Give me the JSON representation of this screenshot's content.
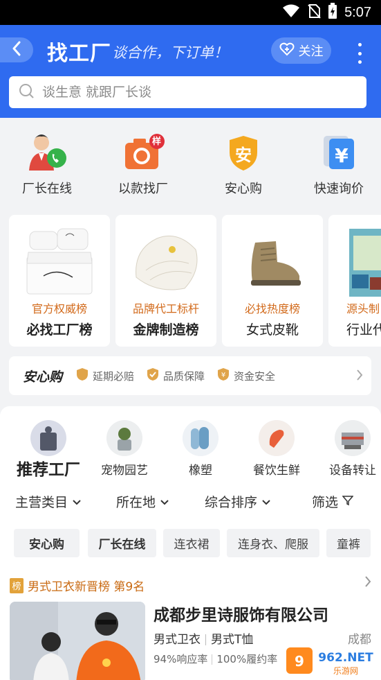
{
  "status_bar": {
    "time": "5:07"
  },
  "header": {
    "brand": "找工厂",
    "slogan": "谈合作，下订单！",
    "follow_label": "关注",
    "search_placeholder": "谈生意 就跟厂长谈"
  },
  "quick_entries": [
    {
      "label": "厂长在线",
      "icon": "factory-manager-phone-icon"
    },
    {
      "label": "以款找厂",
      "icon": "camera-sample-icon",
      "badge": "样"
    },
    {
      "label": "安心购",
      "icon": "shield-icon",
      "glyph": "安"
    },
    {
      "label": "快速询价",
      "icon": "quick-inquiry-icon"
    }
  ],
  "rank_cards": [
    {
      "sub": "官方权威榜",
      "title": "必找工厂榜",
      "image": "bedding-set"
    },
    {
      "sub": "品牌代工标杆",
      "title": "金牌制造榜",
      "image": "quilt"
    },
    {
      "sub": "必找热度榜",
      "title": "女式皮靴",
      "image": "boot"
    },
    {
      "sub": "源头制",
      "title": "行业代",
      "image": "packaging"
    }
  ],
  "assurance": {
    "logo": "安心购",
    "items": [
      "延期必赔",
      "品质保障",
      "资金安全"
    ]
  },
  "categories": [
    {
      "label": "推荐工厂",
      "active": true
    },
    {
      "label": "宠物园艺"
    },
    {
      "label": "橡塑"
    },
    {
      "label": "餐饮生鲜"
    },
    {
      "label": "设备转让"
    }
  ],
  "filters": [
    "主营类目",
    "所在地",
    "综合排序",
    "筛选"
  ],
  "tags": [
    "安心购",
    "厂长在线",
    "连衣裙",
    "连身衣、爬服",
    "童裤"
  ],
  "factory": {
    "rank_badge": "榜",
    "rank_text": "男式卫衣新晋榜 第9名",
    "name": "成都步里诗服饰有限公司",
    "categories": [
      "男式卫衣",
      "男式T恤"
    ],
    "city": "成都",
    "response_rate": "94%响应率",
    "fulfillment_rate": "100%履约率"
  },
  "watermark": {
    "text": "962.NET",
    "sub": "乐游网"
  },
  "colors": {
    "header_blue": "#2f6bf0",
    "accent_orange": "#d26a1b",
    "rank_gold": "#e2a23a"
  }
}
